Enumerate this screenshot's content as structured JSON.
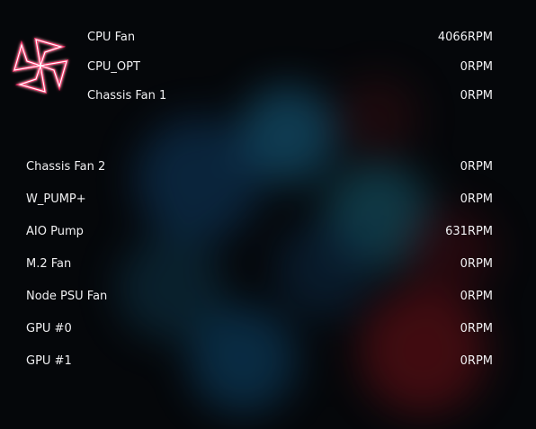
{
  "fans": [
    {
      "label": "CPU Fan",
      "value": "4066RPM"
    },
    {
      "label": "CPU_OPT",
      "value": "0RPM"
    },
    {
      "label": "Chassis Fan 1",
      "value": "0RPM"
    },
    {
      "label": "Chassis Fan 2",
      "value": "0RPM"
    },
    {
      "label": "W_PUMP+",
      "value": "0RPM"
    },
    {
      "label": "AIO Pump",
      "value": "631RPM"
    },
    {
      "label": "M.2 Fan",
      "value": "0RPM"
    },
    {
      "label": "Node PSU Fan",
      "value": "0RPM"
    },
    {
      "label": "GPU #0",
      "value": "0RPM"
    },
    {
      "label": "GPU #1",
      "value": "0RPM"
    }
  ],
  "logo": {
    "icon": "rog-fan-logo-icon",
    "accent": "#ff2d6a"
  },
  "colors": {
    "background": "#05070a",
    "text": "#f0f0f2",
    "glow_blue": "#1a6fa8",
    "glow_red": "#a81a22"
  }
}
